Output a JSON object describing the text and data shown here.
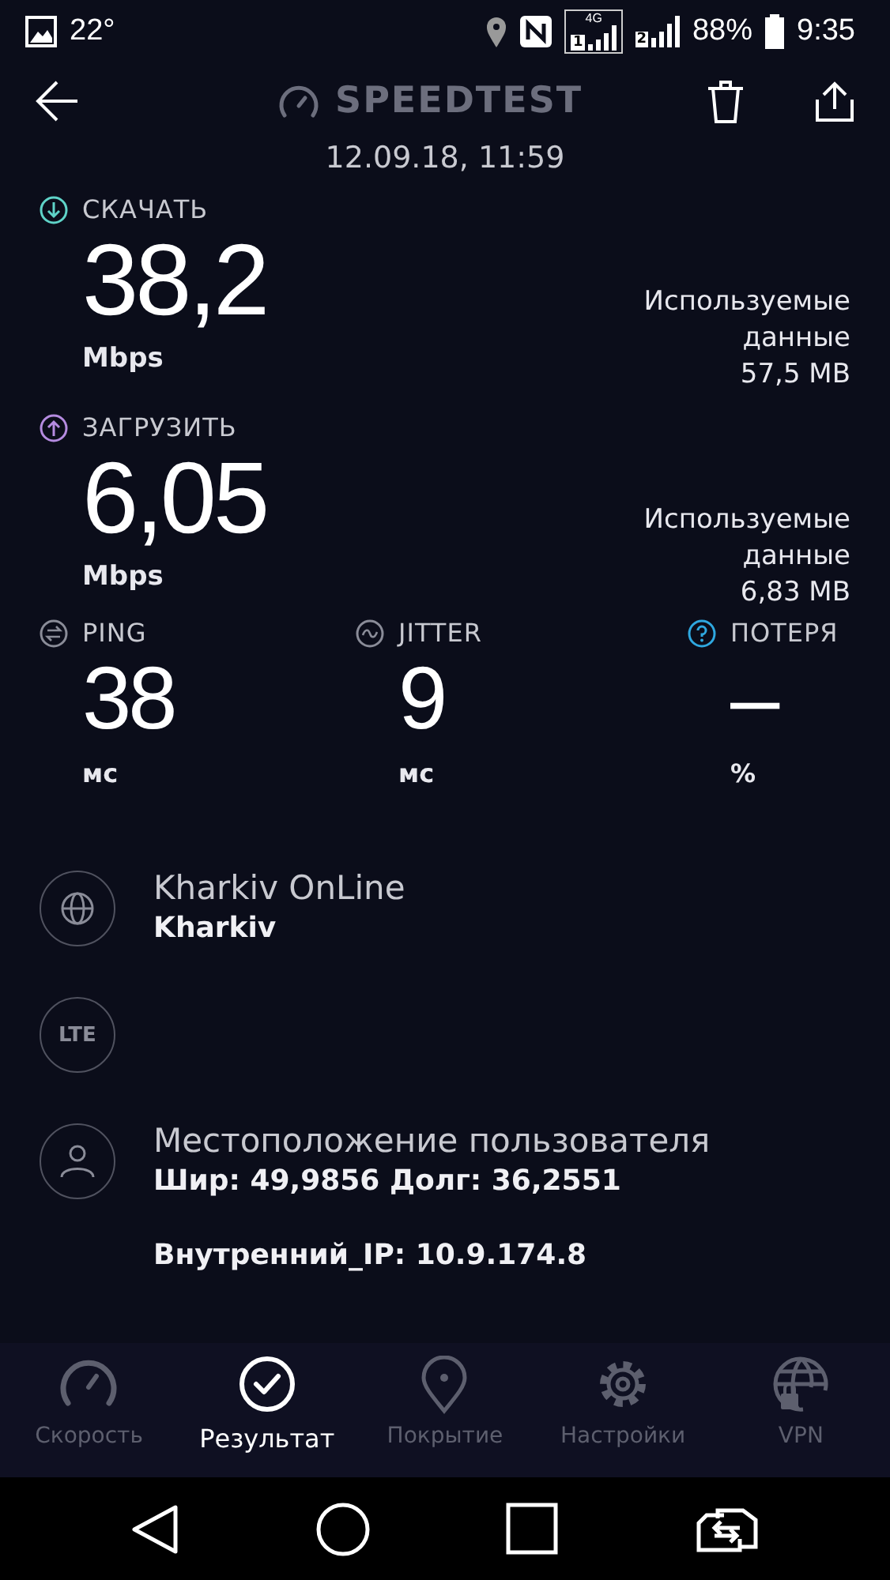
{
  "status_bar": {
    "temperature": "22°",
    "network": "4G",
    "sim_1": "1",
    "sim_2": "2",
    "battery": "88%",
    "time": "9:35"
  },
  "header": {
    "title": "SPEEDTEST",
    "date": "12.09.18, 11:59"
  },
  "speeds": [
    {
      "kind": "download",
      "label": "СКАЧАТЬ",
      "value": "38,2",
      "unit": "Mbps",
      "data_label": "Используемые данные",
      "data_value": "57,5 MB",
      "color": "#5fd3c8"
    },
    {
      "kind": "upload",
      "label": "ЗАГРУЗИТЬ",
      "value": "6,05",
      "unit": "Mbps",
      "data_label": "Используемые данные",
      "data_value": "6,83 MB",
      "color": "#b58be0"
    }
  ],
  "latency": [
    {
      "kind": "ping",
      "label": "PING",
      "value": "38",
      "unit": "мс",
      "color": "#8a8c98"
    },
    {
      "kind": "jitter",
      "label": "JITTER",
      "value": "9",
      "unit": "мс",
      "color": "#8a8c98"
    },
    {
      "kind": "loss",
      "label": "ПОТЕРЯ",
      "value": "–",
      "unit": "%",
      "color": "#2fa8e0"
    }
  ],
  "info": [
    {
      "kind": "globe",
      "title": "Kharkiv OnLine",
      "subtitle": "Kharkiv"
    },
    {
      "kind": "lte",
      "badge": "LTE"
    },
    {
      "kind": "user",
      "title": "Местоположение пользователя",
      "subtitle": "Шир: 49,9856 Долг: 36,2551",
      "extra": "Внутренний_IP: 10.9.174.8"
    }
  ],
  "tabs": [
    {
      "kind": "speed",
      "label": "Скорость",
      "selected": false
    },
    {
      "kind": "result",
      "label": "Результат",
      "selected": true
    },
    {
      "kind": "coverage",
      "label": "Покрытие",
      "selected": false
    },
    {
      "kind": "settings",
      "label": "Настройки",
      "selected": false
    },
    {
      "kind": "vpn",
      "label": "VPN",
      "selected": false
    }
  ]
}
